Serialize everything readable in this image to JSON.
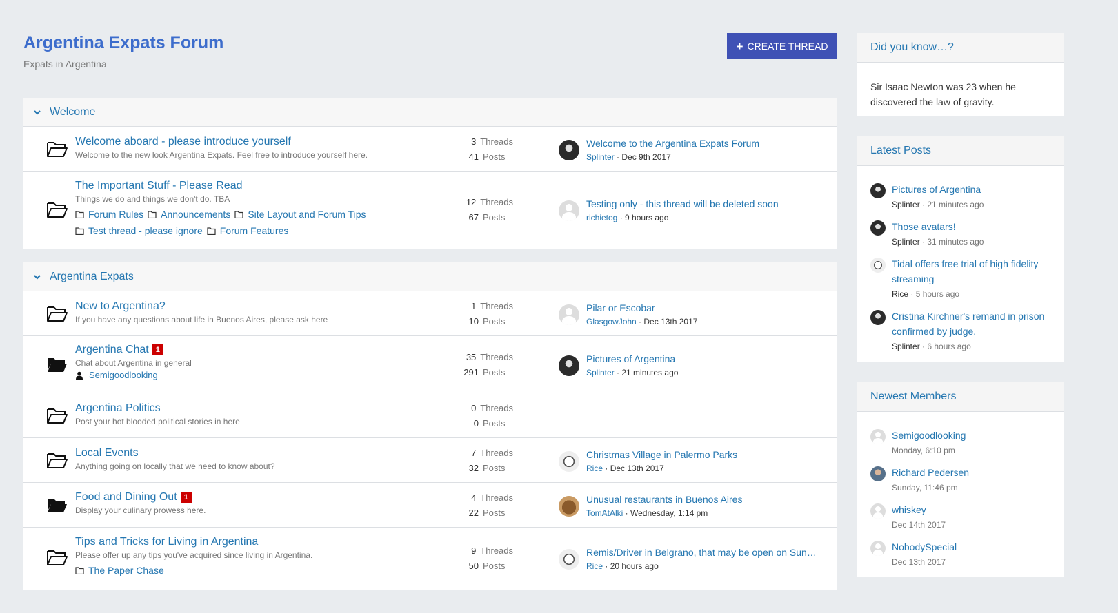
{
  "header": {
    "title": "Argentina Expats Forum",
    "subtitle": "Expats in Argentina",
    "create_label": "CREATE THREAD"
  },
  "labels": {
    "threads": "Threads",
    "posts": "Posts"
  },
  "categories": [
    {
      "name": "Welcome",
      "nodes": [
        {
          "title": "Welcome aboard - please introduce yourself",
          "desc": "Welcome to the new look Argentina Expats. Feel free to introduce yourself here.",
          "threads": "3",
          "posts": "41",
          "last_title": "Welcome to the Argentina Expats Forum",
          "last_user": "Splinter",
          "last_date": "Dec 9th 2017"
        },
        {
          "title": "The Important Stuff - Please Read",
          "desc": "Things we do and things we don't do. TBA",
          "subforums": [
            "Forum Rules",
            "Announcements",
            "Site Layout and Forum Tips",
            "Test thread - please ignore",
            "Forum Features"
          ],
          "threads": "12",
          "posts": "67",
          "last_title": "Testing only - this thread will be deleted soon",
          "last_user": "richietog",
          "last_date": "9 hours ago"
        }
      ]
    },
    {
      "name": "Argentina Expats",
      "nodes": [
        {
          "title": "New to Argentina?",
          "desc": "If you have any questions about life in Buenos Aires, please ask here",
          "threads": "1",
          "posts": "10",
          "last_title": "Pilar or Escobar",
          "last_user": "GlasgowJohn",
          "last_date": "Dec 13th 2017"
        },
        {
          "title": "Argentina Chat",
          "badge": "1",
          "desc": "Chat about Argentina in general",
          "viewer": "Semigoodlooking",
          "threads": "35",
          "posts": "291",
          "last_title": "Pictures of Argentina",
          "last_user": "Splinter",
          "last_date": "21 minutes ago"
        },
        {
          "title": "Argentina Politics",
          "desc": "Post your hot blooded political stories in here",
          "threads": "0",
          "posts": "0"
        },
        {
          "title": "Local Events",
          "desc": "Anything going on locally that we need to know about?",
          "threads": "7",
          "posts": "32",
          "last_title": "Christmas Village in Palermo Parks",
          "last_user": "Rice",
          "last_date": "Dec 13th 2017"
        },
        {
          "title": "Food and Dining Out",
          "badge": "1",
          "desc": "Display your culinary prowess here.",
          "threads": "4",
          "posts": "22",
          "last_title": "Unusual restaurants in Buenos Aires",
          "last_user": "TomAtAlki",
          "last_date": "Wednesday, 1:14 pm"
        },
        {
          "title": "Tips and Tricks for Living in Argentina",
          "desc": "Please offer up any tips you've acquired since living in Argentina.",
          "subforums": [
            "The Paper Chase"
          ],
          "threads": "9",
          "posts": "50",
          "last_title": "Remis/Driver in Belgrano, that may be open on Sunday",
          "last_user": "Rice",
          "last_date": "20 hours ago"
        }
      ]
    }
  ],
  "sidebar": {
    "didyouknow": {
      "title": "Did you know…?",
      "text": "Sir Isaac Newton was 23 when he discovered the law of gravity."
    },
    "latest": {
      "title": "Latest Posts",
      "items": [
        {
          "title": "Pictures of Argentina",
          "user": "Splinter",
          "time": "21 minutes ago"
        },
        {
          "title": "Those avatars!",
          "user": "Splinter",
          "time": "31 minutes ago"
        },
        {
          "title": "Tidal offers free trial of high fidelity streaming",
          "user": "Rice",
          "time": "5 hours ago"
        },
        {
          "title": "Cristina Kirchner's remand in prison confirmed by judge.",
          "user": "Splinter",
          "time": "6 hours ago"
        }
      ]
    },
    "members": {
      "title": "Newest Members",
      "items": [
        {
          "name": "Semigoodlooking",
          "time": "Monday, 6:10 pm"
        },
        {
          "name": "Richard Pedersen",
          "time": "Sunday, 11:46 pm"
        },
        {
          "name": "whiskey",
          "time": "Dec 14th 2017"
        },
        {
          "name": "NobodySpecial",
          "time": "Dec 13th 2017"
        }
      ]
    }
  }
}
